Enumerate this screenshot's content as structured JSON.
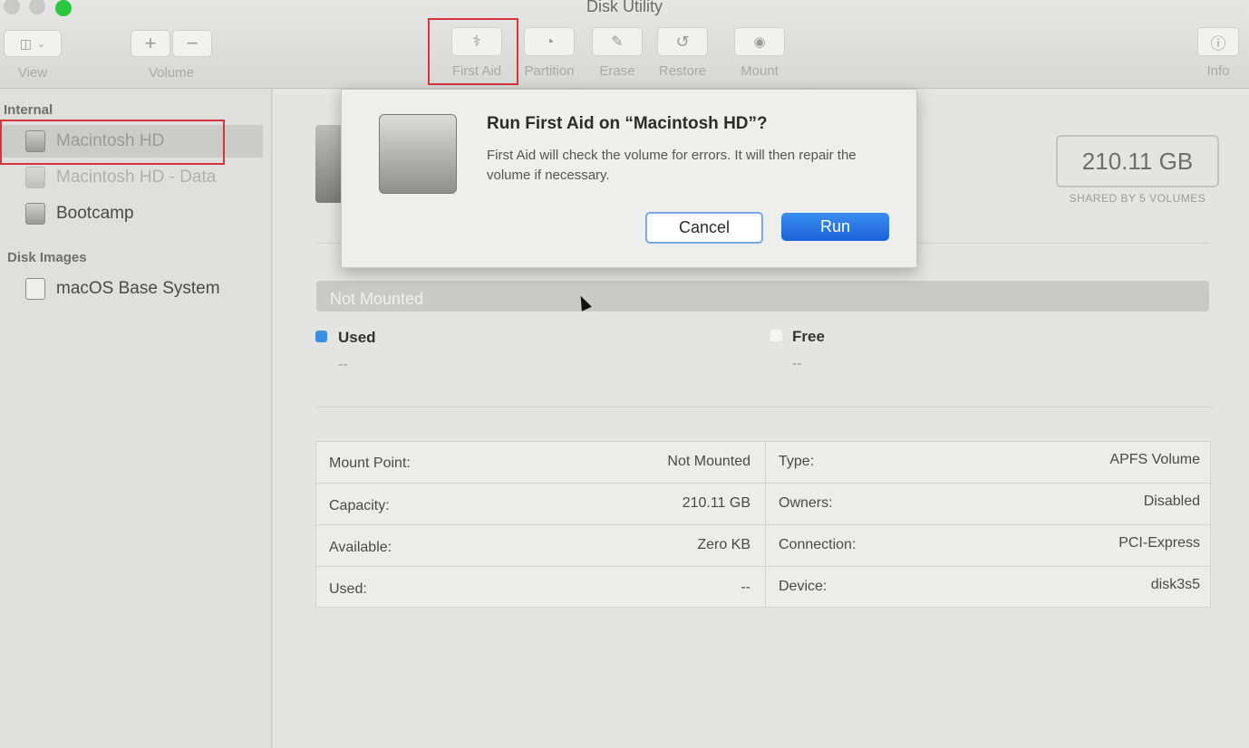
{
  "window": {
    "title": "Disk Utility"
  },
  "toolbar": {
    "view_label": "View",
    "volume_label": "Volume",
    "first_aid_label": "First Aid",
    "partition_label": "Partition",
    "erase_label": "Erase",
    "restore_label": "Restore",
    "mount_label": "Mount",
    "info_label": "Info"
  },
  "sidebar": {
    "internal_label": "Internal",
    "disk_images_label": "Disk Images",
    "items": [
      {
        "label": "Macintosh HD"
      },
      {
        "label": "Macintosh HD - Data"
      },
      {
        "label": "Bootcamp"
      },
      {
        "label": "macOS Base System"
      }
    ]
  },
  "volume": {
    "capacity_display": "210.11 GB",
    "shared_text": "SHARED BY 5 VOLUMES",
    "bar_text": "Not Mounted",
    "used_label": "Used",
    "used_value": "--",
    "free_label": "Free",
    "free_value": "--"
  },
  "info": {
    "left": [
      {
        "label": "Mount Point:",
        "value": "Not Mounted"
      },
      {
        "label": "Capacity:",
        "value": "210.11 GB"
      },
      {
        "label": "Available:",
        "value": "Zero KB"
      },
      {
        "label": "Used:",
        "value": "--"
      }
    ],
    "right": [
      {
        "label": "Type:",
        "value": "APFS Volume"
      },
      {
        "label": "Owners:",
        "value": "Disabled"
      },
      {
        "label": "Connection:",
        "value": "PCI-Express"
      },
      {
        "label": "Device:",
        "value": "disk3s5"
      }
    ]
  },
  "dialog": {
    "title": "Run First Aid on “Macintosh HD”?",
    "message": "First Aid will check the volume for errors. It will then repair the volume if necessary.",
    "cancel_label": "Cancel",
    "run_label": "Run"
  },
  "colors": {
    "accent": "#1a62d8",
    "used_dot": "#3b8fe0",
    "highlight_box": "#d2373a"
  }
}
